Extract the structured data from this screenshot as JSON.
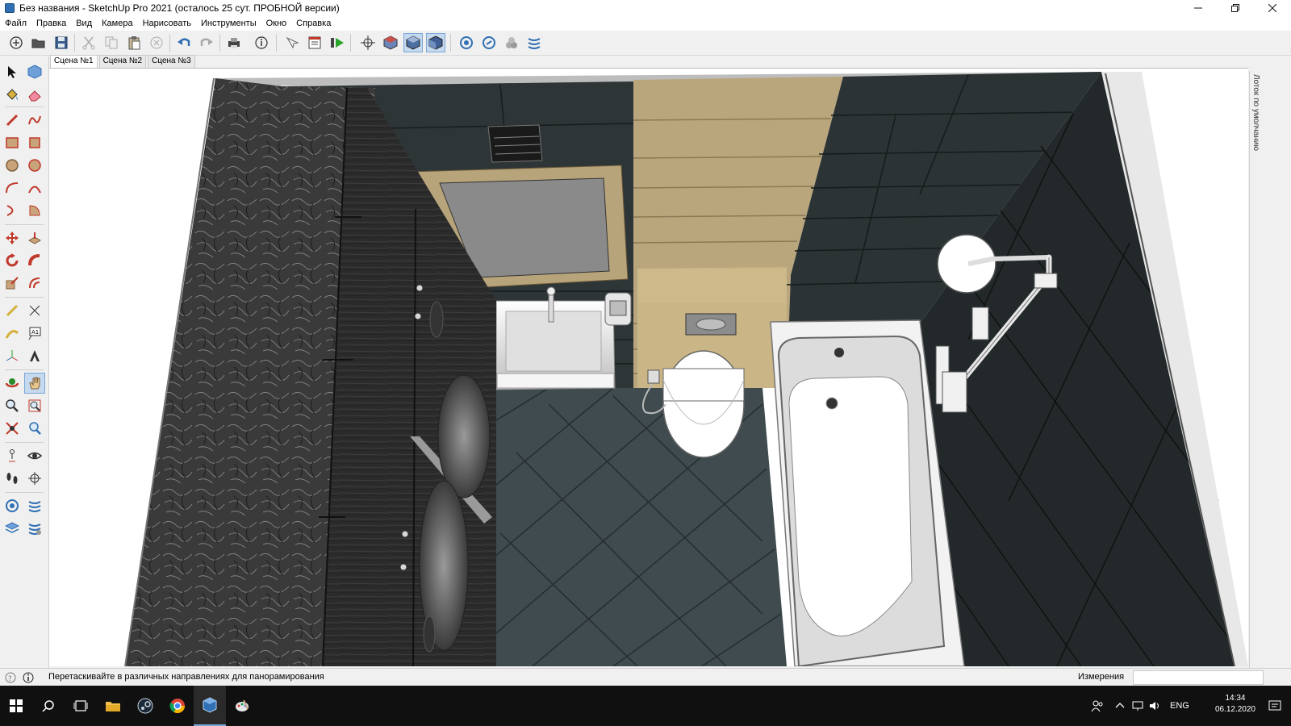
{
  "window": {
    "title": "Без названия - SketchUp Pro 2021 (осталось 25 сут. ПРОБНОЙ версии)"
  },
  "menu": {
    "items": [
      "Файл",
      "Правка",
      "Вид",
      "Камера",
      "Нарисовать",
      "Инструменты",
      "Окно",
      "Справка"
    ]
  },
  "scenes": {
    "tabs": [
      "Сцена №1",
      "Сцена №2",
      "Сцена №3"
    ],
    "active": 0
  },
  "tray": {
    "label": "Лоток по умолчанию"
  },
  "status": {
    "hint": "Перетаскивайте в различных направлениях для панорамирования",
    "measure_label": "Измерения",
    "measure_value": ""
  },
  "taskbar": {
    "lang": "ENG",
    "time": "14:34",
    "date": "06.12.2020"
  },
  "colors": {
    "sketchup_blue": "#2f6fb3",
    "tile_dark": "#2c3335",
    "floor": "#3f4b4e",
    "wood": "#b9a67d",
    "cabinet": "#2b2b2b"
  }
}
